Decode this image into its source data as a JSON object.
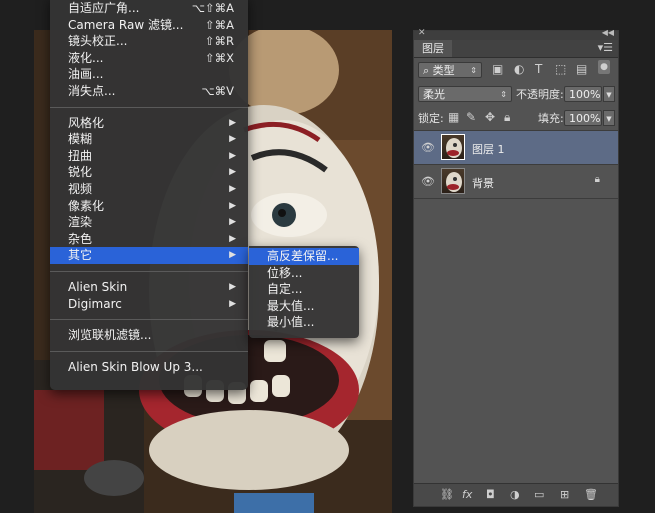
{
  "filter_menu": {
    "group1": [
      {
        "label": "自适应广角...",
        "shortcut": "⌥⇧⌘A"
      },
      {
        "label": "Camera Raw 滤镜...",
        "shortcut": "⇧⌘A"
      },
      {
        "label": "镜头校正...",
        "shortcut": "⇧⌘R"
      },
      {
        "label": "液化...",
        "shortcut": "⇧⌘X"
      },
      {
        "label": "油画...",
        "shortcut": ""
      },
      {
        "label": "消失点...",
        "shortcut": "⌥⌘V"
      }
    ],
    "group2": [
      {
        "label": "风格化"
      },
      {
        "label": "模糊"
      },
      {
        "label": "扭曲"
      },
      {
        "label": "锐化"
      },
      {
        "label": "视频"
      },
      {
        "label": "像素化"
      },
      {
        "label": "渲染"
      },
      {
        "label": "杂色"
      },
      {
        "label": "其它"
      }
    ],
    "group3": [
      {
        "label": "Alien Skin"
      },
      {
        "label": "Digimarc"
      }
    ],
    "browse_online": "浏览联机滤镜...",
    "blow_up": "Alien Skin Blow Up 3...",
    "highlighted": "其它"
  },
  "other_submenu": [
    {
      "label": "高反差保留..."
    },
    {
      "label": "位移..."
    },
    {
      "label": "自定..."
    },
    {
      "label": "最大值..."
    },
    {
      "label": "最小值..."
    }
  ],
  "layers_panel": {
    "tab": "图层",
    "filter_kind": "类型",
    "blend_mode": "柔光",
    "opacity_label": "不透明度:",
    "opacity_value": "100%",
    "lock_label": "锁定:",
    "fill_label": "填充:",
    "fill_value": "100%",
    "layers": [
      {
        "name": "图层 1",
        "selected": true,
        "locked": false
      },
      {
        "name": "背景",
        "selected": false,
        "locked": true
      }
    ]
  },
  "colors": {
    "menu_highlight": "#2a63d8",
    "selected_layer": "#5d6b86"
  }
}
